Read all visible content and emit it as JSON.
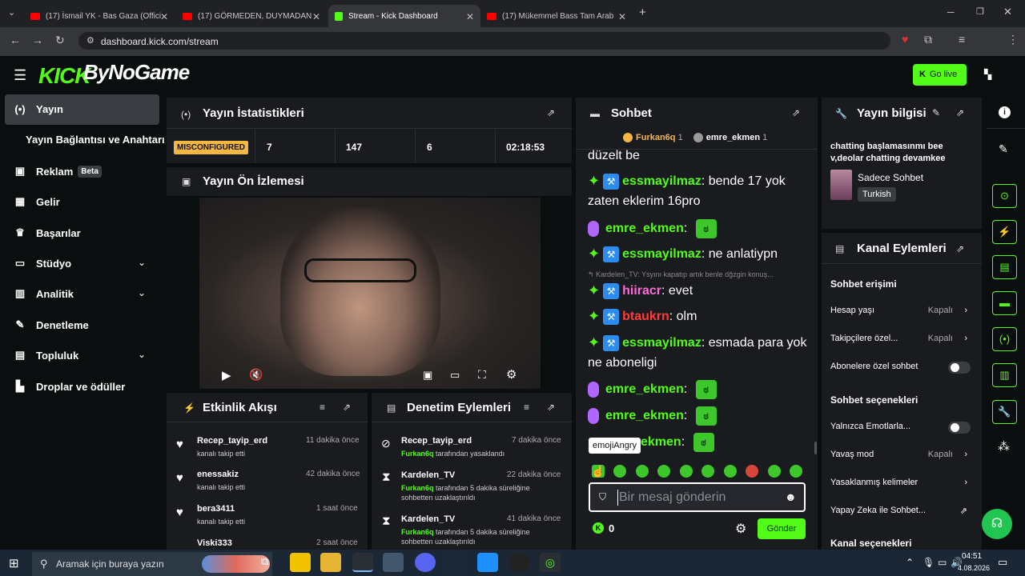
{
  "browser": {
    "tabs": [
      {
        "title": "(17) İsmail YK - Bas Gaza (Offici",
        "active": false
      },
      {
        "title": "(17) GÖRMEDEN, DUYMADAN",
        "active": false
      },
      {
        "title": "Stream - Kick Dashboard",
        "active": true
      },
      {
        "title": "(17) Mükemmel Bass Tam Arab",
        "active": false
      }
    ],
    "url": "dashboard.kick.com/stream"
  },
  "header": {
    "logo_text": "KICK",
    "brand": "ByNoGame",
    "go_live": "Go live"
  },
  "sidebar": {
    "items": [
      {
        "label": "Yayın",
        "icon": "broadcast-icon"
      },
      {
        "label": "Yayın Bağlantısı ve Anahtarı",
        "icon": ""
      },
      {
        "label": "Reklam",
        "icon": "ad-icon",
        "badge": "Beta"
      },
      {
        "label": "Gelir",
        "icon": "revenue-icon"
      },
      {
        "label": "Başarılar",
        "icon": "trophy-icon"
      },
      {
        "label": "Stüdyo",
        "icon": "studio-icon"
      },
      {
        "label": "Analitik",
        "icon": "analytics-icon"
      },
      {
        "label": "Denetleme",
        "icon": "wrench-icon"
      },
      {
        "label": "Topluluk",
        "icon": "community-icon"
      },
      {
        "label": "Droplar ve ödüller",
        "icon": "drops-icon"
      }
    ]
  },
  "stats": {
    "title": "Yayın İstatistikleri",
    "status": "MISCONFIGURED",
    "values": [
      "7",
      "147",
      "6",
      "02:18:53"
    ]
  },
  "preview": {
    "title": "Yayın Ön İzlemesi"
  },
  "activity": {
    "title": "Etkinlik Akışı",
    "items": [
      {
        "name": "Recep_tayip_erd",
        "action": "kanalı takip etti",
        "time": "11 dakika önce"
      },
      {
        "name": "enessakiz",
        "action": "kanalı takip etti",
        "time": "42 dakika önce"
      },
      {
        "name": "bera3411",
        "action": "kanalı takip etti",
        "time": "1 saat önce"
      },
      {
        "name": "Viski333",
        "action": "",
        "time": "2 saat önce"
      }
    ]
  },
  "moderation": {
    "title": "Denetim Eylemleri",
    "items": [
      {
        "name": "Recep_tayip_erd",
        "mod": "Furkan6q",
        "action": "tarafından yasaklandı",
        "time": "7 dakika önce"
      },
      {
        "name": "Kardelen_TV",
        "mod": "Furkan6q",
        "action": "tarafından 5 dakika süreliğine sohbetten uzaklaştırıldı",
        "time": "22 dakika önce"
      },
      {
        "name": "Kardelen_TV",
        "mod": "Furkan6q",
        "action": "tarafından 5 dakika süreliğine sohbetten uzaklaştırıldı",
        "time": "41 dakika önce"
      }
    ]
  },
  "chat": {
    "title": "Sohbet",
    "pinned": [
      {
        "name": "Furkan6q",
        "count": "1"
      },
      {
        "name": "emre_ekmen",
        "count": "1"
      }
    ],
    "top_text": "düzelt be",
    "messages": [
      {
        "user": "essmayilmaz",
        "text": "bende 17 yok zaten eklerim 16pro",
        "color": "#53fc18"
      },
      {
        "user": "emre_ekmen",
        "text": "",
        "color": "#53fc18",
        "emote": true
      },
      {
        "user": "essmayilmaz",
        "text": "ne anlatiypn",
        "color": "#53fc18"
      },
      {
        "reply": "Kardelen_TV: Ysyını kapatıp artık benle dğzgin konuş..."
      },
      {
        "user": "hiiracr",
        "text": "evet",
        "color": "#ff6bd6"
      },
      {
        "user": "btaukrn",
        "text": "olm",
        "color": "#ff3b3b"
      },
      {
        "user": "essmayilmaz",
        "text": "esmada para yok ne aboneligi",
        "color": "#53fc18"
      },
      {
        "user": "emre_ekmen",
        "text": "",
        "color": "#53fc18",
        "emote": true
      },
      {
        "user": "emre_ekmen",
        "text": "",
        "color": "#53fc18",
        "emote": true
      },
      {
        "user": "ekmen",
        "text": "",
        "color": "#53fc18",
        "emote": true
      }
    ],
    "tooltip": "emojiAngry",
    "placeholder": "Bir mesaj gönderin",
    "kick_count": "0",
    "send": "Gönder"
  },
  "stream_info": {
    "title": "Yayın bilgisi",
    "stream_title": "chatting başlamasınmı bee v,deolar chatting devamkee",
    "category": "Sadece Sohbet",
    "language": "Turkish"
  },
  "channel_actions": {
    "title": "Kanal Eylemleri",
    "chat_access": "Sohbet erişimi",
    "rows1": [
      {
        "label": "Hesap yaşı",
        "value": "Kapalı"
      },
      {
        "label": "Takipçilere özel...",
        "value": "Kapalı"
      },
      {
        "label": "Abonelere özel sohbet",
        "value": ""
      }
    ],
    "chat_options": "Sohbet seçenekleri",
    "rows2": [
      {
        "label": "Yalnızca Emotlarla...",
        "value": ""
      },
      {
        "label": "Yavaş mod",
        "value": "Kapalı"
      },
      {
        "label": "Yasaklanmış kelimeler",
        "value": ""
      },
      {
        "label": "Yapay Zeka ile Sohbet...",
        "value": ""
      }
    ],
    "more": "Kanal seçenekleri"
  },
  "taskbar": {
    "search": "Aramak için buraya yazın",
    "time": "04:51",
    "date": "4.08.2026"
  },
  "colors": {
    "accent": "#53fc18",
    "panel": "#191b1f",
    "bg": "#0b0e0f"
  }
}
